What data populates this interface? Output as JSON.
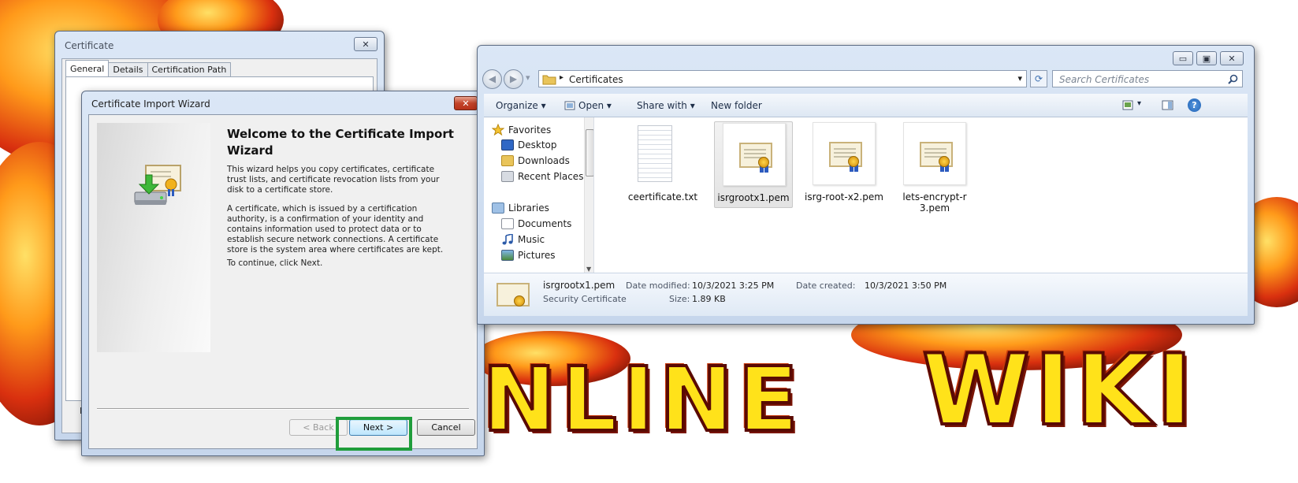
{
  "certificate_window": {
    "title": "Certificate",
    "close_glyph": "✕",
    "tabs": [
      "General",
      "Details",
      "Certification Path"
    ],
    "partial_text": "Le"
  },
  "wizard": {
    "title": "Certificate Import Wizard",
    "close_glyph": "✕",
    "heading": "Welcome to the Certificate Import Wizard",
    "paragraph1": "This wizard helps you copy certificates, certificate trust lists, and certificate revocation lists from your disk to a certificate store.",
    "paragraph2": "A certificate, which is issued by a certification authority, is a confirmation of your identity and contains information used to protect data or to establish secure network connections. A certificate store is the system area where certificates are kept.",
    "paragraph3": "To continue, click Next.",
    "back_label": "< Back",
    "next_label": "Next >",
    "cancel_label": "Cancel",
    "highlight_color": "#1f9d3b"
  },
  "explorer": {
    "caption_buttons": {
      "minimize": "▭",
      "maximize": "▣",
      "close": "✕"
    },
    "nav": {
      "back_glyph": "◀",
      "forward_glyph": "▶",
      "recent_glyph": "▾"
    },
    "address": {
      "separator": "▸",
      "path": "Certificates",
      "dropdown_glyph": "▾",
      "refresh_glyph": "⟳"
    },
    "search": {
      "placeholder": "Search Certificates"
    },
    "toolbar": {
      "organize": "Organize ▾",
      "open": "Open ▾",
      "share_with": "Share with ▾",
      "new_folder": "New folder",
      "view_glyph": "▾",
      "help_glyph": "?"
    },
    "tree": {
      "favorites": "Favorites",
      "items_fav": [
        "Desktop",
        "Downloads",
        "Recent Places"
      ],
      "libraries": "Libraries",
      "items_lib": [
        "Documents",
        "Music",
        "Pictures"
      ]
    },
    "files": [
      {
        "name": "ceertificate.txt",
        "kind": "text"
      },
      {
        "name": "isrgrootx1.pem",
        "kind": "cert",
        "selected": true
      },
      {
        "name": "isrg-root-x2.pem",
        "kind": "cert"
      },
      {
        "name": "lets-encrypt-r3.pem",
        "kind": "cert"
      }
    ],
    "details": {
      "file_name": "isrgrootx1.pem",
      "file_type": "Security Certificate",
      "date_modified_label": "Date modified:",
      "date_modified": "10/3/2021 3:25 PM",
      "date_created_label": "Date created:",
      "date_created": "10/3/2021 3:50 PM",
      "size_label": "Size:",
      "size": "1.89 KB"
    }
  },
  "wallpaper": {
    "banner_words": [
      "NLINE",
      "WIKI"
    ]
  },
  "colors": {
    "accent_blue": "#3c7fb1",
    "window_frame": "#c6d6ec",
    "banner_yellow": "#ffe21a"
  }
}
